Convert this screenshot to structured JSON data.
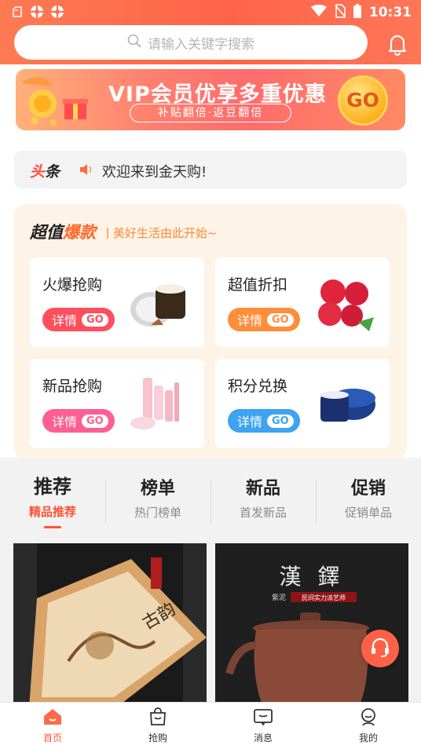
{
  "status_bar": {
    "time": "10:31"
  },
  "search": {
    "placeholder": "请输入关键字搜索"
  },
  "banner": {
    "title": "VIP会员优享多重优惠",
    "subtitle": "补贴翻倍·返豆翻倍",
    "go": "GO"
  },
  "news": {
    "tag_a": "头",
    "tag_b": "条",
    "text": "欢迎来到金天购!"
  },
  "deals": {
    "title_a": "超值",
    "title_b": "爆款",
    "subtitle": "美好生活由此开始~",
    "cards": [
      {
        "title": "火爆抢购",
        "button": "详情",
        "go": "GO",
        "color": "#ff4e5c"
      },
      {
        "title": "超值折扣",
        "button": "详情",
        "go": "GO",
        "color": "#ff8d3a"
      },
      {
        "title": "新品抢购",
        "button": "详情",
        "go": "GO",
        "color": "#ff5e92"
      },
      {
        "title": "积分兑换",
        "button": "详情",
        "go": "GO",
        "color": "#3ea3f0"
      }
    ]
  },
  "tabs": [
    {
      "title": "推荐",
      "subtitle": "精品推荐"
    },
    {
      "title": "榜单",
      "subtitle": "热门榜单"
    },
    {
      "title": "新品",
      "subtitle": "首发新品"
    },
    {
      "title": "促销",
      "subtitle": "促销单品"
    }
  ],
  "products": [
    {
      "label": "古韵"
    },
    {
      "label_title": "漢 鐸",
      "label_sub": "民间实力派艺师",
      "label_sub_prefix": "紫泥"
    }
  ],
  "bottom_nav": [
    {
      "label": "首页",
      "icon": "home-icon"
    },
    {
      "label": "抢购",
      "icon": "bag-icon"
    },
    {
      "label": "消息",
      "icon": "message-icon"
    },
    {
      "label": "我的",
      "icon": "user-icon"
    }
  ],
  "colors": {
    "brand": "#ff6448",
    "accent": "#ff5233"
  }
}
